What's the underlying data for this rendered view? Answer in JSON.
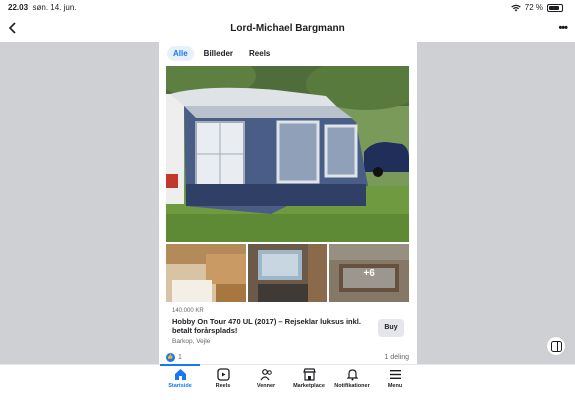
{
  "status": {
    "time": "22.03",
    "date": "søn. 14. jun.",
    "battery": "72 %"
  },
  "header": {
    "title": "Lord-Michael Bargmann",
    "more": "•••"
  },
  "tabs": [
    {
      "label": "Alle",
      "active": true
    },
    {
      "label": "Billeder",
      "active": false
    },
    {
      "label": "Reels",
      "active": false
    }
  ],
  "listing": {
    "price": "140.000 KR",
    "title": "Hobby On Tour 470 UL (2017) – Rejseklar luksus inkl. betalt forårsplads!",
    "location": "Barkop, Vejle",
    "buy_label": "Buy",
    "more_photos": "+6"
  },
  "engagement": {
    "likes": "1",
    "shares": "1 deling"
  },
  "bottom_nav": [
    {
      "label": "Startside",
      "icon": "home-icon",
      "active": true
    },
    {
      "label": "Reels",
      "icon": "reels-icon",
      "active": false
    },
    {
      "label": "Venner",
      "icon": "friends-icon",
      "active": false
    },
    {
      "label": "Marketplace",
      "icon": "marketplace-icon",
      "active": false
    },
    {
      "label": "Notifikationer",
      "icon": "bell-icon",
      "active": false
    },
    {
      "label": "Menu",
      "icon": "menu-icon",
      "active": false
    }
  ],
  "colors": {
    "accent": "#1877f2",
    "side_background": "#ced0d4"
  }
}
